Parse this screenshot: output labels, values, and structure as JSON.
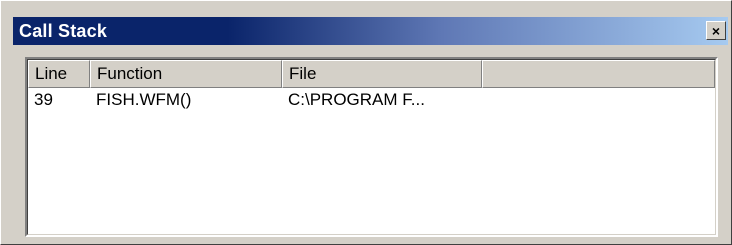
{
  "window": {
    "title": "Call Stack",
    "close_glyph": "×"
  },
  "table": {
    "columns": [
      {
        "label": "Line"
      },
      {
        "label": "Function"
      },
      {
        "label": "File"
      },
      {
        "label": ""
      }
    ],
    "rows": [
      {
        "line": "39",
        "function": "FISH.WFM()",
        "file": "C:\\PROGRAM F..."
      }
    ]
  },
  "colors": {
    "titlebar_start": "#0a246a",
    "titlebar_end": "#a6caf0",
    "face": "#d4d0c8"
  }
}
